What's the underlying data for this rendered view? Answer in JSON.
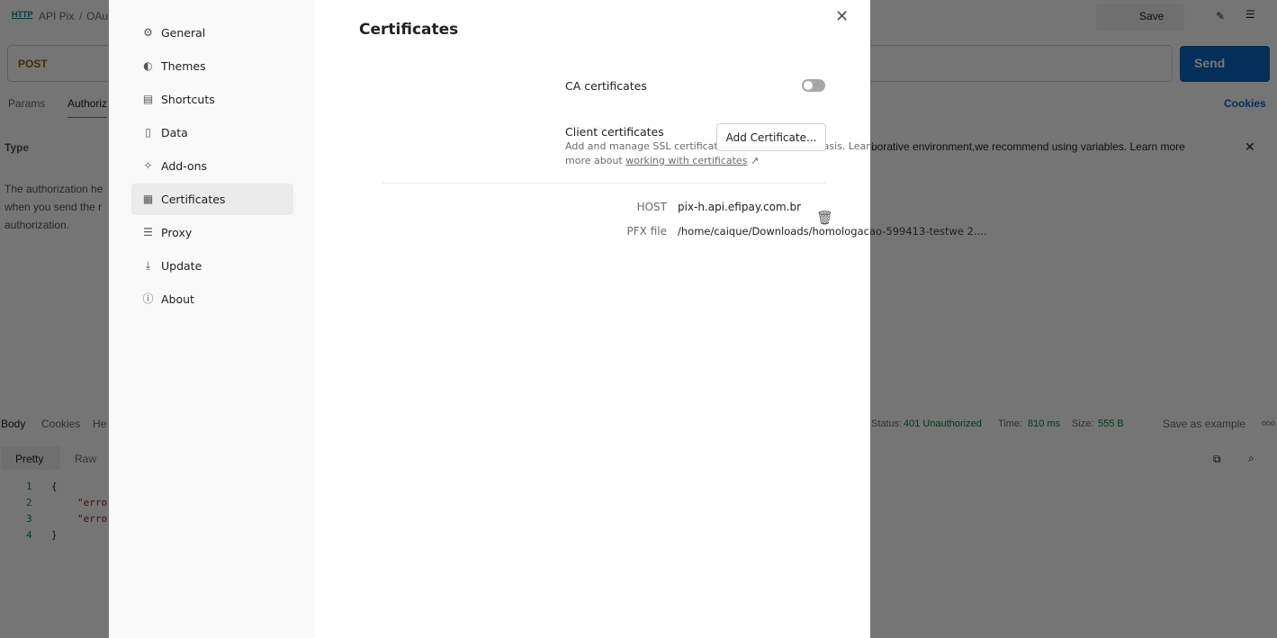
{
  "background": {
    "breadcrumb": [
      "API Pix",
      "/",
      "OAu"
    ],
    "http_icon": "HTTP",
    "save_label": "Save",
    "method": "POST",
    "send_label": "Send",
    "tabs": [
      "Params",
      "Authoriz"
    ],
    "cookies_link": "Cookies",
    "type_label": "Type",
    "auth_text": [
      "The authorization he",
      "when you send the r",
      "authorization."
    ],
    "banner_text": "borative environment,we recommend using variables. Learn more",
    "response_tabs": [
      "Body",
      "Cookies",
      "He"
    ],
    "status_label": "Status:",
    "status_value": "401 Unauthorized",
    "time_label": "Time:",
    "time_value": "810 ms",
    "size_label": "Size:",
    "size_value": "555 B",
    "save_example": "Save as example",
    "more": "ooo",
    "view_tabs": [
      "Pretty",
      "Raw"
    ],
    "line_numbers": [
      "1",
      "2",
      "3",
      "4"
    ],
    "code_lines": [
      "{",
      "\"erro",
      "\"erro",
      "}"
    ]
  },
  "settings": {
    "nav": [
      {
        "label": "General",
        "icon": "gear-icon"
      },
      {
        "label": "Themes",
        "icon": "palette-icon"
      },
      {
        "label": "Shortcuts",
        "icon": "keyboard-icon"
      },
      {
        "label": "Data",
        "icon": "data-icon"
      },
      {
        "label": "Add-ons",
        "icon": "sparkle-icon"
      },
      {
        "label": "Certificates",
        "icon": "certificate-icon",
        "active": true
      },
      {
        "label": "Proxy",
        "icon": "server-icon"
      },
      {
        "label": "Update",
        "icon": "download-icon"
      },
      {
        "label": "About",
        "icon": "info-icon"
      }
    ],
    "title": "Certificates",
    "ca_label": "CA certificates",
    "ca_enabled": false,
    "client_label": "Client certificates",
    "client_desc": "Add and manage SSL certificates on a per domain basis. Learn more about",
    "client_link": "working with certificates",
    "add_button": "Add Certificate...",
    "cert": {
      "host_label": "HOST",
      "host": "pix-h.api.efipay.com.br",
      "pfx_label": "PFX file",
      "pfx": "/home/caique/Downloads/homologacao-599413-testwe 2...."
    }
  }
}
